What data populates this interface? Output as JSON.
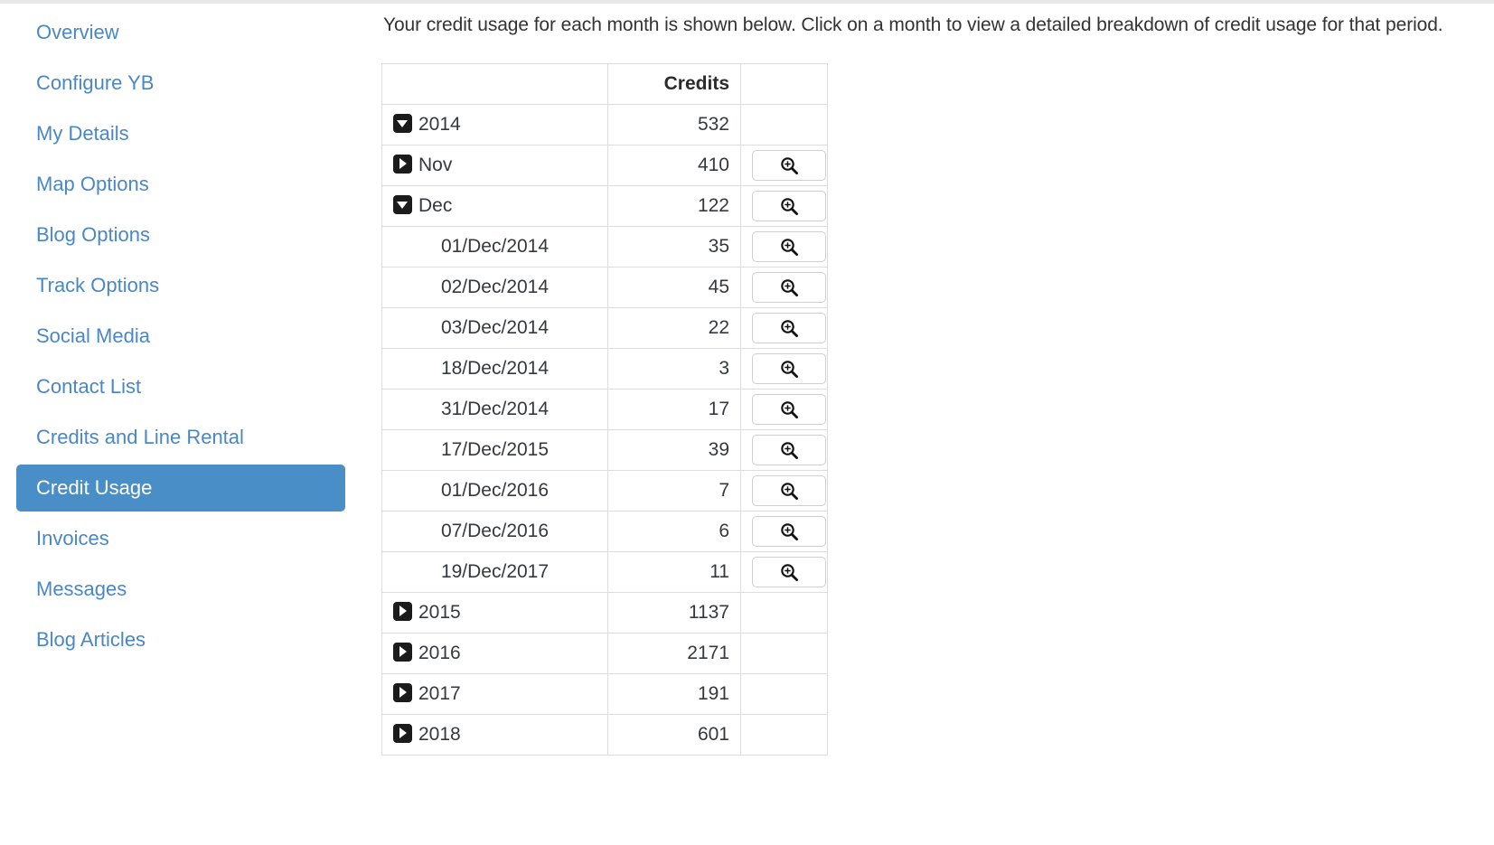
{
  "sidebar": {
    "items": [
      {
        "label": "Overview",
        "active": false
      },
      {
        "label": "Configure YB",
        "active": false
      },
      {
        "label": "My Details",
        "active": false
      },
      {
        "label": "Map Options",
        "active": false
      },
      {
        "label": "Blog Options",
        "active": false
      },
      {
        "label": "Track Options",
        "active": false
      },
      {
        "label": "Social Media",
        "active": false
      },
      {
        "label": "Contact List",
        "active": false
      },
      {
        "label": "Credits and Line Rental",
        "active": false
      },
      {
        "label": "Credit Usage",
        "active": true
      },
      {
        "label": "Invoices",
        "active": false
      },
      {
        "label": "Messages",
        "active": false
      },
      {
        "label": "Blog Articles",
        "active": false
      }
    ],
    "active_color": "#4a8ec7",
    "link_color": "#4a87c7"
  },
  "main": {
    "intro": "Your credit usage for each month is shown below. Click on a month to view a detailed breakdown of credit usage for that period.",
    "table": {
      "headers": [
        "",
        "Credits",
        ""
      ],
      "zoom_button_label": "zoom-in-icon",
      "rows": [
        {
          "type": "year",
          "twisty": "down",
          "label": "2014",
          "credits": "532",
          "action": false
        },
        {
          "type": "month",
          "twisty": "right",
          "label": "Nov",
          "credits": "410",
          "action": true
        },
        {
          "type": "month",
          "twisty": "down",
          "label": "Dec",
          "credits": "122",
          "action": true
        },
        {
          "type": "day",
          "twisty": null,
          "label": "01/Dec/2014",
          "credits": "35",
          "action": true
        },
        {
          "type": "day",
          "twisty": null,
          "label": "02/Dec/2014",
          "credits": "45",
          "action": true
        },
        {
          "type": "day",
          "twisty": null,
          "label": "03/Dec/2014",
          "credits": "22",
          "action": true
        },
        {
          "type": "day",
          "twisty": null,
          "label": "18/Dec/2014",
          "credits": "3",
          "action": true
        },
        {
          "type": "day",
          "twisty": null,
          "label": "31/Dec/2014",
          "credits": "17",
          "action": true
        },
        {
          "type": "day",
          "twisty": null,
          "label": "17/Dec/2015",
          "credits": "39",
          "action": true
        },
        {
          "type": "day",
          "twisty": null,
          "label": "01/Dec/2016",
          "credits": "7",
          "action": true
        },
        {
          "type": "day",
          "twisty": null,
          "label": "07/Dec/2016",
          "credits": "6",
          "action": true
        },
        {
          "type": "day",
          "twisty": null,
          "label": "19/Dec/2017",
          "credits": "11",
          "action": true
        },
        {
          "type": "year",
          "twisty": "right",
          "label": "2015",
          "credits": "1137",
          "action": false
        },
        {
          "type": "year",
          "twisty": "right",
          "label": "2016",
          "credits": "2171",
          "action": false
        },
        {
          "type": "year",
          "twisty": "right",
          "label": "2017",
          "credits": "191",
          "action": false
        },
        {
          "type": "year",
          "twisty": "right",
          "label": "2018",
          "credits": "601",
          "action": false
        }
      ]
    }
  }
}
